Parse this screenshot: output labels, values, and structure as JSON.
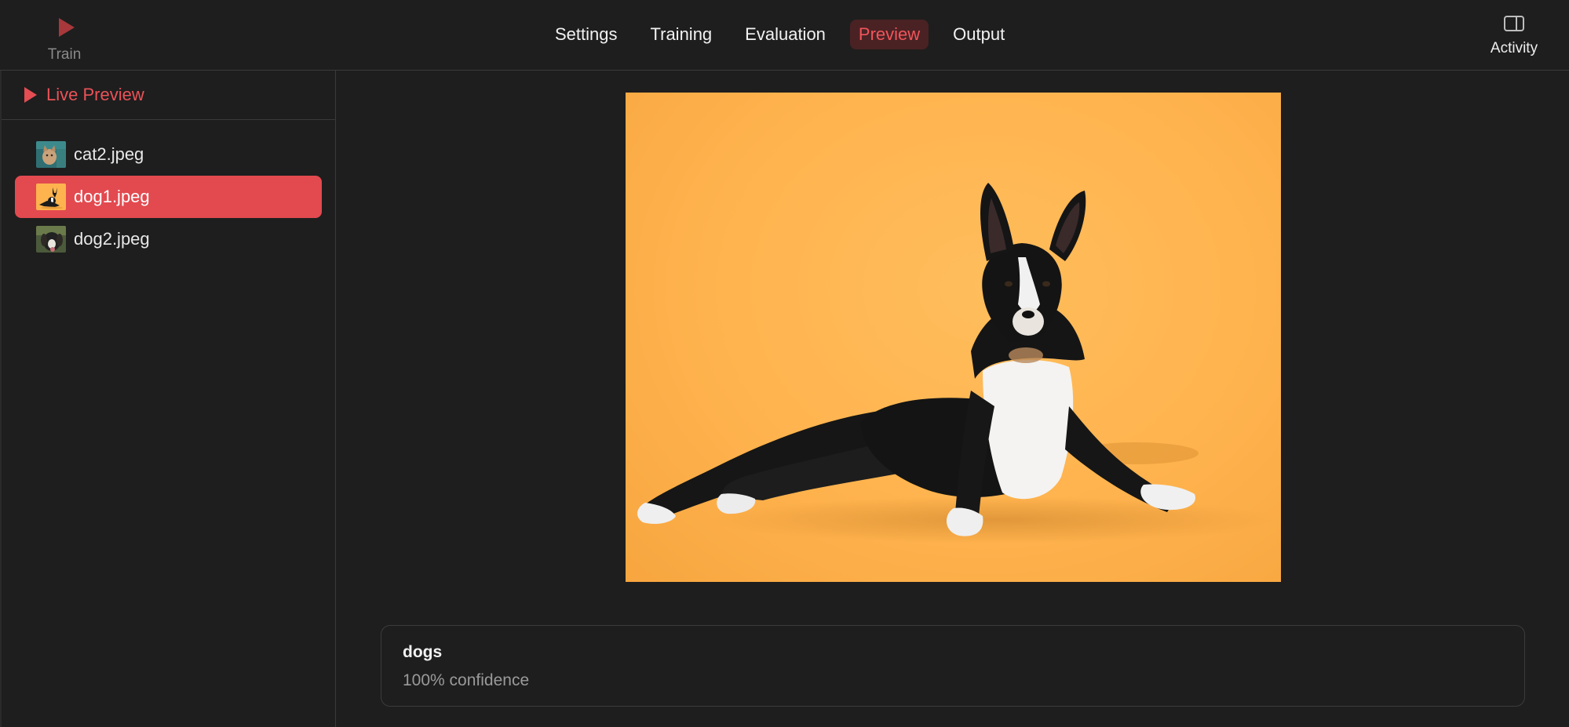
{
  "toolbar": {
    "train_label": "Train",
    "activity_label": "Activity",
    "tabs": [
      {
        "label": "Settings"
      },
      {
        "label": "Training"
      },
      {
        "label": "Evaluation"
      },
      {
        "label": "Preview",
        "active": true
      },
      {
        "label": "Output"
      }
    ]
  },
  "sidebar": {
    "header": "Live Preview",
    "files": [
      {
        "name": "cat2.jpeg",
        "selected": false
      },
      {
        "name": "dog1.jpeg",
        "selected": true
      },
      {
        "name": "dog2.jpeg",
        "selected": false
      }
    ]
  },
  "preview": {
    "result_label": "dogs",
    "confidence_text": "100% confidence"
  },
  "colors": {
    "accent": "#e24a4f",
    "accent_text": "#ea5358",
    "background": "#1e1e1e",
    "image_background": "#ffb34e"
  },
  "icons": {
    "train": "play-icon",
    "activity": "sidebar-toggle-icon",
    "live_preview": "play-icon"
  }
}
